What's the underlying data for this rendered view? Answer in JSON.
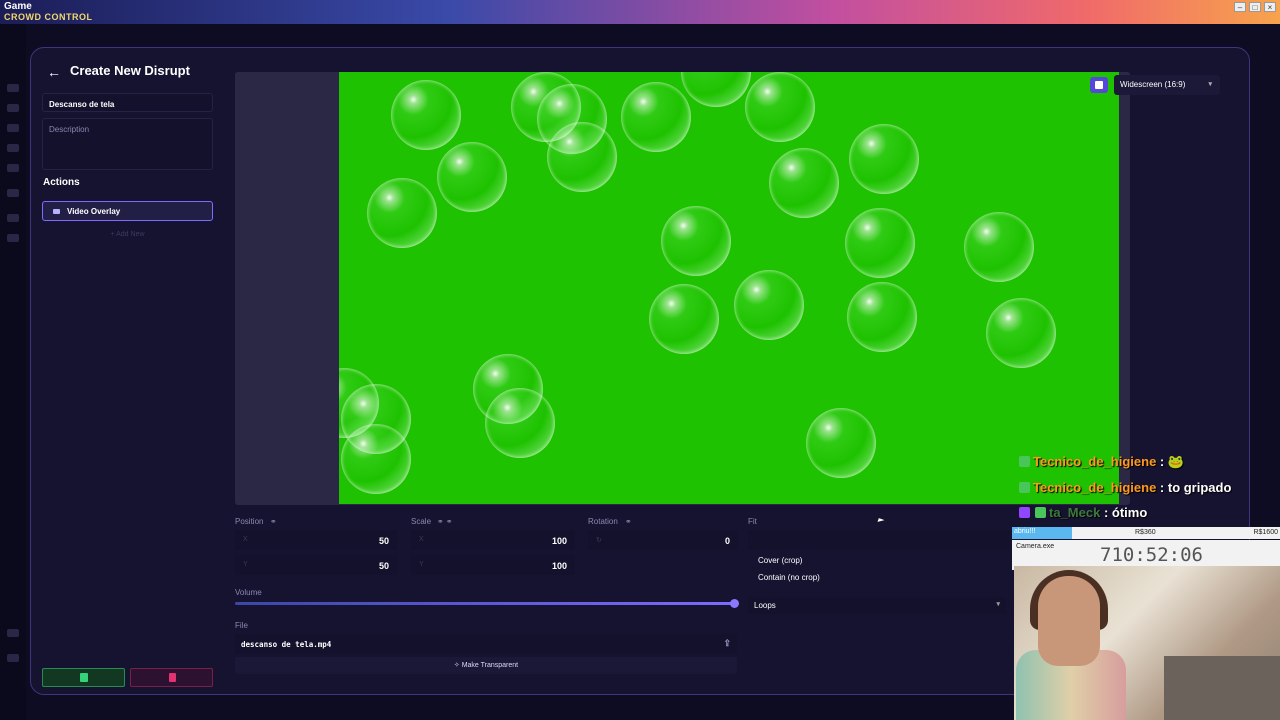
{
  "window": {
    "title": "Game",
    "app_name": "CROWD CONTROL"
  },
  "panel": {
    "title": "Create New Disrupt",
    "name_value": "Descanso de tela",
    "description_placeholder": "Description",
    "actions_heading": "Actions",
    "action_item": "Video Overlay",
    "add_new": "Add New"
  },
  "preview": {
    "aspect": "Widescreen (16:9)"
  },
  "controls": {
    "position_label": "Position",
    "position_x": "50",
    "position_y": "50",
    "scale_label": "Scale",
    "scale_x": "100",
    "scale_y": "100",
    "rotation_label": "Rotation",
    "rotation_value": "0",
    "x_label": "X",
    "y_label": "Y",
    "fit_label": "Fit",
    "fit_options": [
      "Cover (crop)",
      "Contain (no crop)"
    ],
    "loop_value": "Loops",
    "volume_label": "Volume",
    "volume_level": 1.0,
    "file_label": "File",
    "file_value": "descanso de tela.mp4",
    "make_transparent": "Make Transparent"
  },
  "chat": [
    {
      "name": "Tecnico_de_higiene",
      "message": ": 🐸"
    },
    {
      "name": "Tecnico_de_higiene",
      "message": ": to gripado"
    },
    {
      "name": "ta_Meck",
      "message": ": ótimo"
    }
  ],
  "webcam": {
    "tab1": "abriu!!!",
    "money1": "R$360",
    "money2": "R$1600",
    "window": "Camera.exe",
    "timer": "710:52:06"
  },
  "colors": {
    "accent": "#7e6bff",
    "green_screen": "#1ec200",
    "chat_name": "#ff9a1f"
  }
}
